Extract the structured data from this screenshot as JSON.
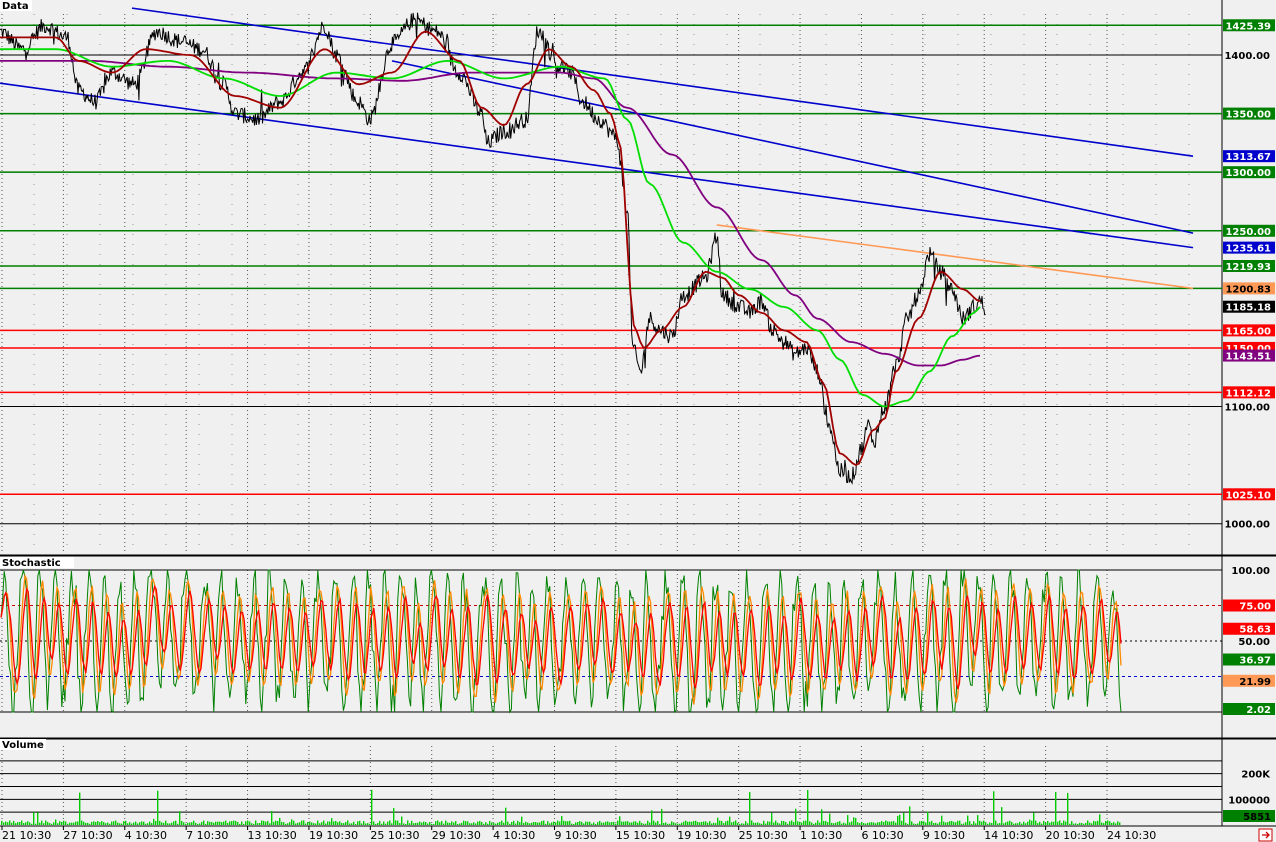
{
  "panels": {
    "price_title": "Data",
    "stoch_title": "Stochastic",
    "volume_title": "Volume"
  },
  "colors": {
    "bg": "#f0f0f0",
    "price": "#000000",
    "ma_fast": "#a00000",
    "ma_mid": "#00dd00",
    "ma_slow": "#800080",
    "support_green": "#008000",
    "resistance_red": "#ff0000",
    "trend_blue": "#0000cc",
    "trend_orange": "#ff9955",
    "stoch_k": "#008000",
    "stoch_d": "#ff0000",
    "stoch_s": "#ff8800",
    "volume": "#00cc00"
  },
  "chart_data": [
    {
      "type": "line",
      "panel": "price",
      "ylim": [
        975,
        1435
      ],
      "y_ticks": [
        1400.0,
        1350.0,
        1300.0,
        1250.0,
        1100.0,
        1000.0
      ],
      "x_tick_labels": [
        "21 10:30",
        "27 10:30",
        "4 10:30",
        "7 10:30",
        "13 10:30",
        "19 10:30",
        "25 10:30",
        "29 10:30",
        "4 10:30",
        "9 10:30",
        "15 10:30",
        "19 10:30",
        "25 10:30",
        "1 10:30",
        "6 10:30",
        "9 10:30",
        "14 10:30",
        "20 10:30",
        "24 10:30"
      ],
      "horizontal_levels": [
        {
          "value": 1425.39,
          "label": "1425.39",
          "color": "green"
        },
        {
          "value": 1350.0,
          "label": "1350.00",
          "color": "green"
        },
        {
          "value": 1300.0,
          "label": "1300.00",
          "color": "green"
        },
        {
          "value": 1250.0,
          "label": "1250.00",
          "color": "green"
        },
        {
          "value": 1219.93,
          "label": "1219.93",
          "color": "green"
        },
        {
          "value": 1200.83,
          "label": "1200.83",
          "color": "green"
        },
        {
          "value": 1165.0,
          "label": "1165.00",
          "color": "red"
        },
        {
          "value": 1150.0,
          "label": "1150.00",
          "color": "red"
        },
        {
          "value": 1112.12,
          "label": "1112.12",
          "color": "red"
        },
        {
          "value": 1025.1,
          "label": "1025.10",
          "color": "red"
        }
      ],
      "level_tags": [
        {
          "value": 1313.67,
          "label": "1313.67",
          "color": "blue"
        },
        {
          "value": 1235.61,
          "label": "1235.61",
          "color": "blue"
        },
        {
          "value": 1200.83,
          "label": "1200.83",
          "color": "orange"
        },
        {
          "value": 1185.18,
          "label": "1185.18",
          "color": "black"
        },
        {
          "value": 1143.51,
          "label": "1143.51",
          "color": "purple"
        }
      ],
      "trend_lines": [
        {
          "color": "blue",
          "from": [
            0.1,
            1440
          ],
          "to": [
            0.935,
            1313.67
          ]
        },
        {
          "color": "blue",
          "from": [
            0.0,
            1376
          ],
          "to": [
            0.935,
            1235.61
          ]
        },
        {
          "color": "blue",
          "from": [
            0.35,
            1395
          ],
          "to": [
            0.935,
            1248
          ]
        },
        {
          "color": "orange",
          "from": [
            0.64,
            1255
          ],
          "to": [
            0.935,
            1200.83
          ]
        }
      ],
      "price_keypoints": [
        [
          0.0,
          1420
        ],
        [
          0.02,
          1405
        ],
        [
          0.04,
          1425
        ],
        [
          0.06,
          1415
        ],
        [
          0.07,
          1370
        ],
        [
          0.085,
          1360
        ],
        [
          0.1,
          1385
        ],
        [
          0.12,
          1375
        ],
        [
          0.14,
          1420
        ],
        [
          0.16,
          1412
        ],
        [
          0.18,
          1405
        ],
        [
          0.2,
          1375
        ],
        [
          0.21,
          1350
        ],
        [
          0.23,
          1345
        ],
        [
          0.25,
          1360
        ],
        [
          0.27,
          1385
        ],
        [
          0.29,
          1425
        ],
        [
          0.3,
          1400
        ],
        [
          0.32,
          1360
        ],
        [
          0.33,
          1345
        ],
        [
          0.35,
          1410
        ],
        [
          0.37,
          1430
        ],
        [
          0.39,
          1420
        ],
        [
          0.41,
          1385
        ],
        [
          0.43,
          1350
        ],
        [
          0.435,
          1325
        ],
        [
          0.45,
          1335
        ],
        [
          0.47,
          1345
        ],
        [
          0.48,
          1420
        ],
        [
          0.5,
          1390
        ],
        [
          0.51,
          1385
        ],
        [
          0.52,
          1360
        ],
        [
          0.535,
          1345
        ],
        [
          0.55,
          1330
        ],
        [
          0.56,
          1270
        ],
        [
          0.565,
          1150
        ],
        [
          0.572,
          1130
        ],
        [
          0.58,
          1175
        ],
        [
          0.59,
          1165
        ],
        [
          0.6,
          1160
        ],
        [
          0.61,
          1195
        ],
        [
          0.63,
          1210
        ],
        [
          0.64,
          1245
        ],
        [
          0.645,
          1195
        ],
        [
          0.66,
          1185
        ],
        [
          0.67,
          1180
        ],
        [
          0.68,
          1190
        ],
        [
          0.69,
          1165
        ],
        [
          0.7,
          1155
        ],
        [
          0.71,
          1145
        ],
        [
          0.72,
          1150
        ],
        [
          0.73,
          1130
        ],
        [
          0.74,
          1085
        ],
        [
          0.75,
          1045
        ],
        [
          0.76,
          1040
        ],
        [
          0.77,
          1065
        ],
        [
          0.775,
          1085
        ],
        [
          0.78,
          1070
        ],
        [
          0.79,
          1100
        ],
        [
          0.8,
          1135
        ],
        [
          0.81,
          1175
        ],
        [
          0.82,
          1195
        ],
        [
          0.83,
          1230
        ],
        [
          0.84,
          1215
        ],
        [
          0.85,
          1200
        ],
        [
          0.86,
          1175
        ],
        [
          0.87,
          1185
        ],
        [
          0.875,
          1190
        ],
        [
          0.88,
          1185
        ]
      ],
      "ma_fast_keypoints": [
        [
          0.0,
          1415
        ],
        [
          0.05,
          1415
        ],
        [
          0.07,
          1395
        ],
        [
          0.1,
          1385
        ],
        [
          0.13,
          1405
        ],
        [
          0.17,
          1400
        ],
        [
          0.21,
          1365
        ],
        [
          0.25,
          1355
        ],
        [
          0.29,
          1405
        ],
        [
          0.32,
          1375
        ],
        [
          0.35,
          1385
        ],
        [
          0.38,
          1420
        ],
        [
          0.41,
          1395
        ],
        [
          0.43,
          1355
        ],
        [
          0.45,
          1340
        ],
        [
          0.47,
          1375
        ],
        [
          0.49,
          1405
        ],
        [
          0.51,
          1390
        ],
        [
          0.53,
          1370
        ],
        [
          0.545,
          1350
        ],
        [
          0.555,
          1320
        ],
        [
          0.56,
          1240
        ],
        [
          0.565,
          1170
        ],
        [
          0.575,
          1150
        ],
        [
          0.59,
          1165
        ],
        [
          0.61,
          1185
        ],
        [
          0.63,
          1215
        ],
        [
          0.645,
          1210
        ],
        [
          0.66,
          1195
        ],
        [
          0.68,
          1180
        ],
        [
          0.7,
          1165
        ],
        [
          0.72,
          1155
        ],
        [
          0.735,
          1120
        ],
        [
          0.75,
          1060
        ],
        [
          0.765,
          1050
        ],
        [
          0.78,
          1080
        ],
        [
          0.79,
          1090
        ],
        [
          0.8,
          1130
        ],
        [
          0.82,
          1175
        ],
        [
          0.84,
          1215
        ],
        [
          0.86,
          1200
        ],
        [
          0.875,
          1190
        ]
      ],
      "ma_mid_keypoints": [
        [
          0.0,
          1405
        ],
        [
          0.05,
          1405
        ],
        [
          0.1,
          1390
        ],
        [
          0.15,
          1395
        ],
        [
          0.2,
          1380
        ],
        [
          0.25,
          1365
        ],
        [
          0.3,
          1385
        ],
        [
          0.35,
          1380
        ],
        [
          0.4,
          1395
        ],
        [
          0.45,
          1380
        ],
        [
          0.5,
          1390
        ],
        [
          0.54,
          1380
        ],
        [
          0.56,
          1345
        ],
        [
          0.58,
          1290
        ],
        [
          0.61,
          1240
        ],
        [
          0.64,
          1215
        ],
        [
          0.67,
          1200
        ],
        [
          0.7,
          1185
        ],
        [
          0.73,
          1165
        ],
        [
          0.75,
          1140
        ],
        [
          0.77,
          1110
        ],
        [
          0.79,
          1100
        ],
        [
          0.81,
          1105
        ],
        [
          0.83,
          1130
        ],
        [
          0.85,
          1160
        ],
        [
          0.87,
          1180
        ],
        [
          0.875,
          1185
        ]
      ],
      "ma_slow_keypoints": [
        [
          0.0,
          1395
        ],
        [
          0.08,
          1395
        ],
        [
          0.15,
          1390
        ],
        [
          0.22,
          1385
        ],
        [
          0.3,
          1380
        ],
        [
          0.36,
          1378
        ],
        [
          0.42,
          1385
        ],
        [
          0.5,
          1385
        ],
        [
          0.53,
          1380
        ],
        [
          0.56,
          1355
        ],
        [
          0.6,
          1315
        ],
        [
          0.64,
          1270
        ],
        [
          0.68,
          1225
        ],
        [
          0.71,
          1195
        ],
        [
          0.73,
          1175
        ],
        [
          0.76,
          1155
        ],
        [
          0.79,
          1145
        ],
        [
          0.82,
          1135
        ],
        [
          0.84,
          1135
        ],
        [
          0.86,
          1140
        ],
        [
          0.875,
          1143.51
        ]
      ]
    },
    {
      "type": "line",
      "panel": "stochastic",
      "ylim": [
        0,
        100
      ],
      "y_ticks": [
        100.0,
        50.0
      ],
      "reference_levels": [
        75,
        50,
        25
      ],
      "level_tags": [
        {
          "value": 75,
          "label": "75.00",
          "color": "red"
        },
        {
          "value": 58.63,
          "label": "58.63",
          "color": "red"
        },
        {
          "value": 36.97,
          "label": "36.97",
          "color": "green"
        },
        {
          "value": 21.99,
          "label": "21.99",
          "color": "orange"
        },
        {
          "value": 2.02,
          "label": "2.02",
          "color": "green"
        }
      ]
    },
    {
      "type": "bar",
      "panel": "volume",
      "ylim": [
        0,
        300000
      ],
      "y_ticks": [
        {
          "value": 200000,
          "label": "200K"
        },
        {
          "value": 100000,
          "label": "100000"
        }
      ],
      "level_tags": [
        {
          "value": 5851,
          "label": "5851",
          "color": "green"
        }
      ]
    }
  ]
}
